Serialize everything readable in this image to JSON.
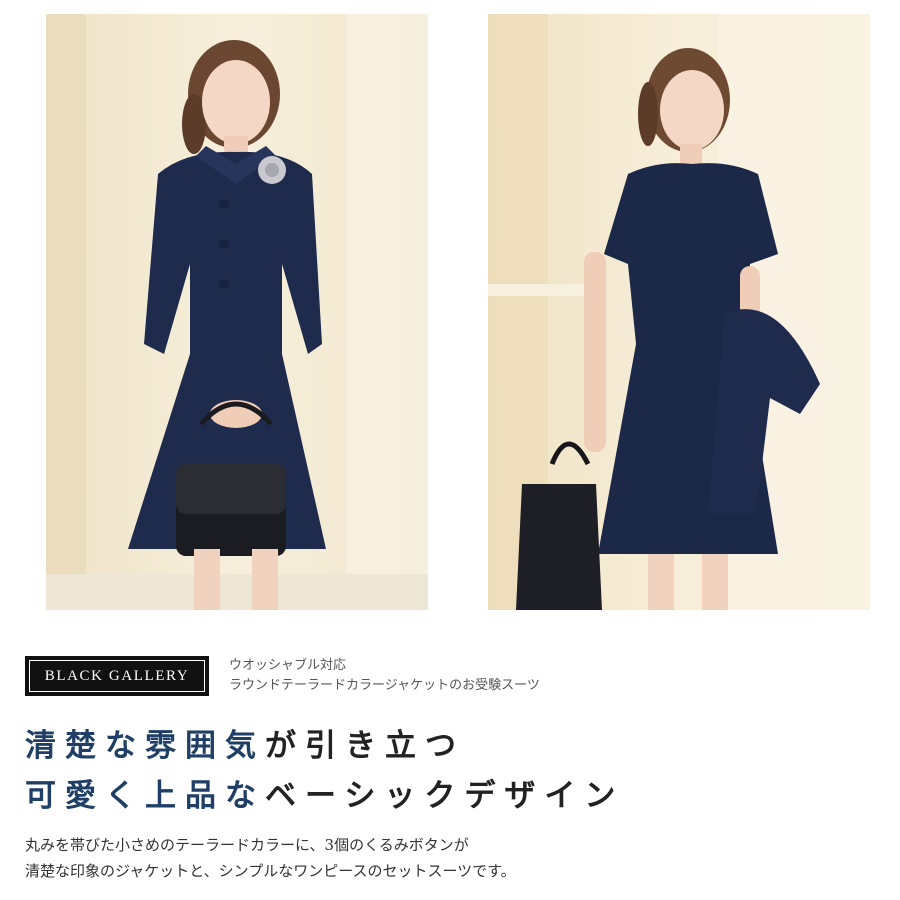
{
  "brand": {
    "logo_text": "BLACK GALLERY",
    "subtitle_line1": "ウオッシャブル対応",
    "subtitle_line2": "ラウンドテーラードカラージャケットのお受験スーツ"
  },
  "headline": {
    "line1_accent": "清楚な雰囲気",
    "line1_rest": "が引き立つ",
    "line2_accent": "可愛く上品な",
    "line2_rest": "ベーシックデザイン"
  },
  "description": {
    "line1": "丸みを帯びた小さめのテーラードカラーに、3個のくるみボタンが",
    "line2": "清楚な印象のジャケットと、シンプルなワンピースのセットスーツです。"
  },
  "colors": {
    "navy": "#1c2847",
    "accent_text": "#1f3f66",
    "background_wall": "#f3ead6"
  }
}
